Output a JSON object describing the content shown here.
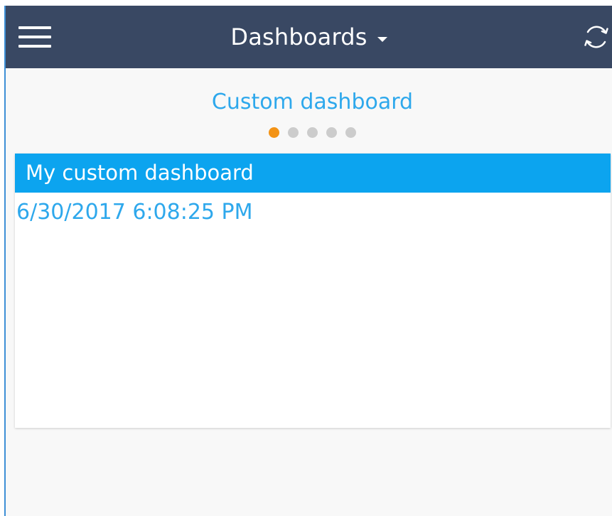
{
  "header": {
    "title": "Dashboards",
    "menu_icon": "hamburger-menu-icon",
    "dropdown_icon": "caret-down-icon",
    "refresh_icon": "refresh-icon",
    "background_color": "#394863"
  },
  "carousel": {
    "title": "Custom dashboard",
    "pages": 5,
    "active_page": 1,
    "active_color": "#f39315",
    "inactive_color": "#cccccc"
  },
  "card": {
    "title": "My custom dashboard",
    "timestamp": "6/30/2017 6:08:25 PM",
    "header_color": "#0ca4ef",
    "accent_color": "#2ea8ec"
  }
}
